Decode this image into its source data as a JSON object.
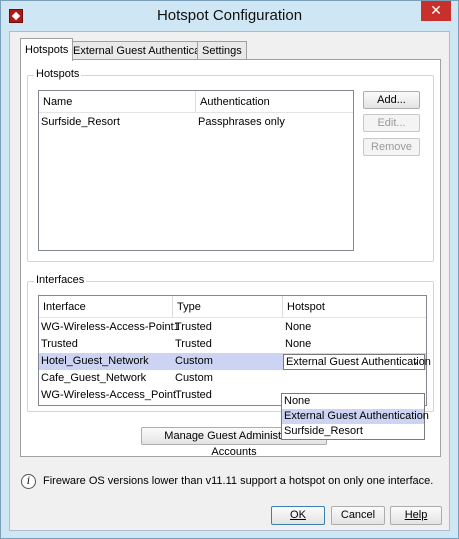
{
  "window": {
    "title": "Hotspot Configuration",
    "close_glyph": "✕"
  },
  "tabs": [
    {
      "label": "Hotspots",
      "active": true
    },
    {
      "label": "External Guest Authentication",
      "active": false
    },
    {
      "label": "Settings",
      "active": false
    }
  ],
  "hotspots": {
    "group_label": "Hotspots",
    "columns": [
      "Name",
      "Authentication"
    ],
    "rows": [
      {
        "name": "Surfside_Resort",
        "authentication": "Passphrases only"
      }
    ],
    "buttons": {
      "add": "Add...",
      "edit": "Edit...",
      "remove": "Remove"
    }
  },
  "interfaces": {
    "group_label": "Interfaces",
    "columns": [
      "Interface",
      "Type",
      "Hotspot"
    ],
    "rows": [
      {
        "interface": "WG-Wireless-Access-Point1",
        "type": "Trusted",
        "hotspot": "None"
      },
      {
        "interface": "Trusted",
        "type": "Trusted",
        "hotspot": "None"
      },
      {
        "interface": "Hotel_Guest_Network",
        "type": "Custom",
        "hotspot": "External Guest Authentication"
      },
      {
        "interface": "Cafe_Guest_Network",
        "type": "Custom",
        "hotspot": ""
      },
      {
        "interface": "WG-Wireless-Access_Point",
        "type": "Trusted",
        "hotspot": ""
      }
    ],
    "dropdown_options": [
      "None",
      "External Guest Authentication",
      "Surfside_Resort"
    ],
    "dropdown_highlight": "External Guest Authentication"
  },
  "manage_button": "Manage Guest Administrator Accounts",
  "info_note": "Fireware OS versions lower than v11.11 support a hotspot on only one interface.",
  "footer": {
    "ok": "OK",
    "cancel": "Cancel",
    "help": "Help"
  },
  "colors": {
    "selection": "#cdd3f2",
    "titlebar": "#cfe7f5",
    "close": "#c9302c"
  }
}
